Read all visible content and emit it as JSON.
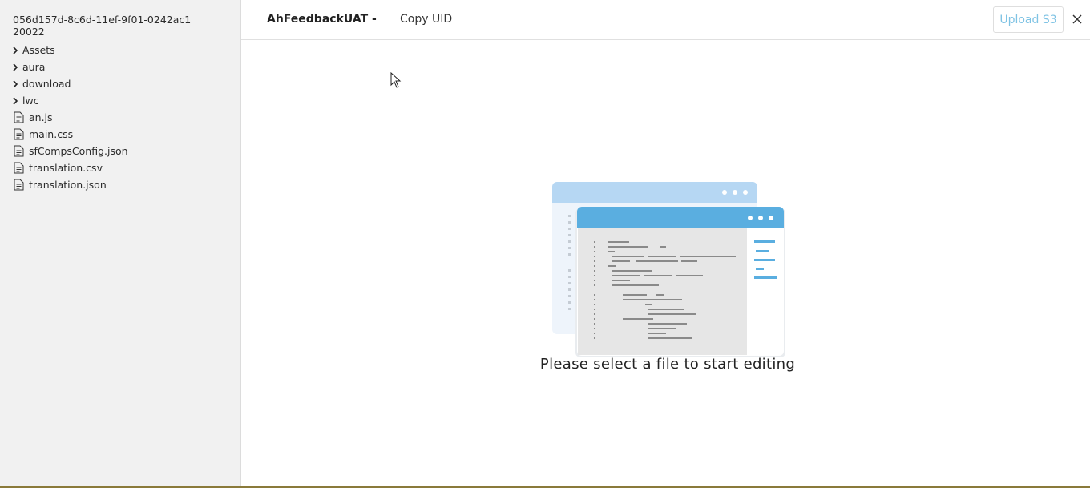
{
  "sidebar": {
    "root_name": "056d157d-8c6d-11ef-9f01-0242ac120022",
    "items": [
      {
        "label": "Assets",
        "type": "folder"
      },
      {
        "label": "aura",
        "type": "folder"
      },
      {
        "label": "download",
        "type": "folder"
      },
      {
        "label": "lwc",
        "type": "folder"
      },
      {
        "label": "an.js",
        "type": "file"
      },
      {
        "label": "main.css",
        "type": "file"
      },
      {
        "label": "sfCompsConfig.json",
        "type": "file"
      },
      {
        "label": "translation.csv",
        "type": "file"
      },
      {
        "label": "translation.json",
        "type": "file"
      }
    ]
  },
  "header": {
    "project_title": "AhFeedbackUAT -",
    "copy_uid_label": "Copy UID",
    "upload_label": "Upload S3",
    "close_icon": "close-icon"
  },
  "main": {
    "empty_state_text": "Please select a file to start editing",
    "illustration_icon": "code-editor-illustration"
  },
  "colors": {
    "sidebar_bg": "#f1f1f1",
    "accent": "#5aaee0",
    "upload_text": "#7fc3e4"
  }
}
